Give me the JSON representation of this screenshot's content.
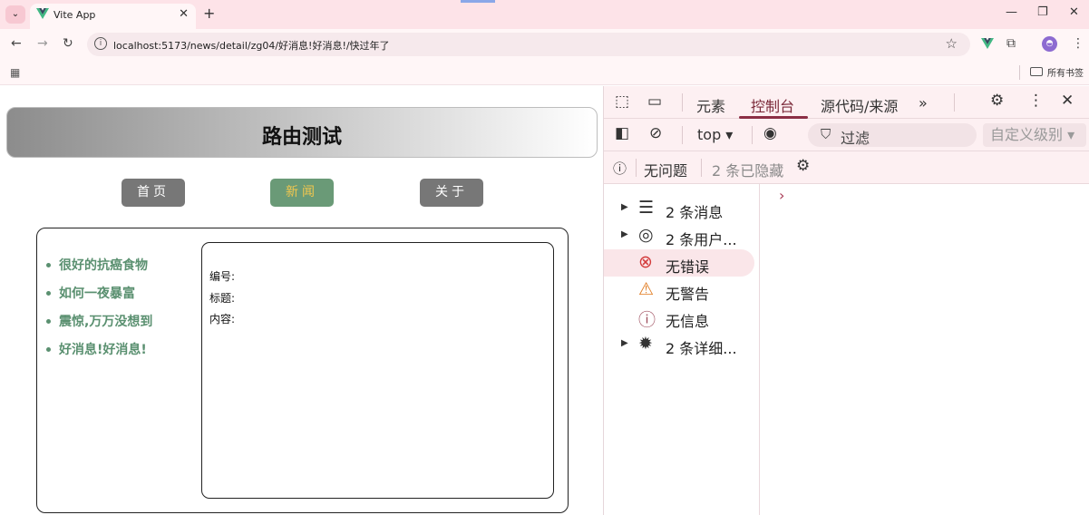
{
  "browser": {
    "tab_title": "Vite App",
    "url": "localhost:5173/news/detail/zg04/好消息!好消息!/快过年了",
    "bookmarks_label": "所有书签"
  },
  "page": {
    "title": "路由测试",
    "nav": [
      {
        "label": "首页",
        "active": false
      },
      {
        "label": "新闻",
        "active": true
      },
      {
        "label": "关于",
        "active": false
      }
    ],
    "news_list": [
      "很好的抗癌食物",
      "如何一夜暴富",
      "震惊,万万没想到",
      "好消息!好消息!"
    ],
    "detail": {
      "id_label": "编号:",
      "title_label": "标题:",
      "content_label": "内容:"
    },
    "colors": {
      "link_green": "#5a9070",
      "active_nav_bg": "#6a9a77",
      "active_nav_text": "#f2c74e",
      "nav_bg": "#777777"
    }
  },
  "devtools": {
    "tabs": [
      "元素",
      "控制台",
      "源代码/来源"
    ],
    "active_tab": "控制台",
    "context": "top",
    "filter_placeholder": "过滤",
    "levels": "自定义级别",
    "issues": "无问题",
    "hidden": "2 条已隐藏",
    "sidebar": [
      {
        "label": "2 条消息",
        "icon": "list-icon",
        "expandable": true
      },
      {
        "label": "2 条用户...",
        "icon": "user-icon",
        "expandable": true
      },
      {
        "label": "无错误",
        "icon": "error-icon",
        "expandable": false,
        "selected": true
      },
      {
        "label": "无警告",
        "icon": "warning-icon",
        "expandable": false
      },
      {
        "label": "无信息",
        "icon": "info-icon",
        "expandable": false
      },
      {
        "label": "2 条详细...",
        "icon": "bug-icon",
        "expandable": true
      }
    ],
    "prompt": "›"
  }
}
